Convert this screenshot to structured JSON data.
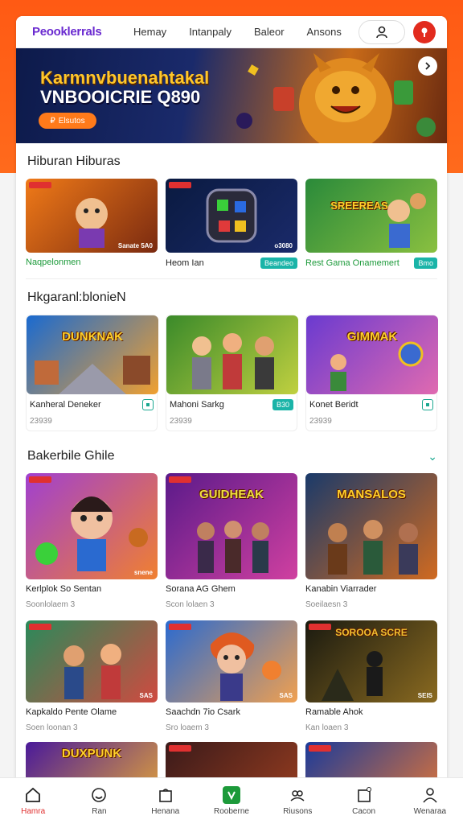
{
  "header": {
    "logo": "Peooklerrals",
    "nav": [
      "Hemay",
      "Intanpaly",
      "Baleor",
      "Ansons"
    ]
  },
  "banner": {
    "title": "Karmnvbuenahtakal",
    "subtitle": "VNBOOICRIE Q890",
    "cta": "Elsutos"
  },
  "sections": [
    {
      "title": "Hiburan Hiburas",
      "cards": [
        {
          "name": "Naqpelonmen",
          "badge": "",
          "thumb_label": "",
          "corner": "Sanate 5A0",
          "colors": [
            "#f07a18",
            "#7a2a10"
          ]
        },
        {
          "name": "Heom Ian",
          "badge": "Beandeo",
          "thumb_label": "",
          "corner": "o3080",
          "colors": [
            "#0a1a40",
            "#1a2a6a"
          ]
        },
        {
          "name": "Rest Gama Onamemert",
          "badge": "Bmo",
          "thumb_label": "SREEREAS",
          "corner": "",
          "colors": [
            "#2a8a3a",
            "#8ac040"
          ]
        }
      ]
    },
    {
      "title": "Hkgaranl:blonieN",
      "cards": [
        {
          "name": "Kanheral Deneker",
          "sub": "23939",
          "badge": "",
          "thumb_label": "DUNKNAK",
          "corner": "",
          "colors": [
            "#1a6ad0",
            "#f0a030"
          ]
        },
        {
          "name": "Mahoni Sarkg",
          "sub": "23939",
          "badge": "B30",
          "thumb_label": "",
          "corner": "",
          "colors": [
            "#3a8a2a",
            "#c0d040"
          ]
        },
        {
          "name": "Konet Beridt",
          "sub": "23939",
          "badge": "",
          "thumb_label": "GIMMAK",
          "corner": "",
          "colors": [
            "#6a3ad0",
            "#e06ab0"
          ]
        }
      ]
    },
    {
      "title": "Bakerbile Ghile",
      "cards": [
        {
          "name": "Kerlplok So Sentan",
          "sub": "Soonlolaem 3",
          "thumb_label": "",
          "corner": "snene",
          "colors": [
            "#a040d0",
            "#f08030"
          ]
        },
        {
          "name": "Sorana AG Ghem",
          "sub": "Scon lolaen 3",
          "thumb_label": "GUIDHEAK",
          "corner": "",
          "colors": [
            "#5a1a8a",
            "#d040a0"
          ]
        },
        {
          "name": "Kanabin Viarrader",
          "sub": "Soeilaesn 3",
          "thumb_label": "MANSALOS",
          "corner": "",
          "colors": [
            "#1a3a6a",
            "#d06a20"
          ]
        }
      ]
    },
    {
      "title": "",
      "cards": [
        {
          "name": "Kapkaldo Pente Olame",
          "sub": "Soen loonan 3",
          "thumb_label": "",
          "corner": "SAS",
          "colors": [
            "#2a8a5a",
            "#d04a40"
          ]
        },
        {
          "name": "Saachdn 7io Csark",
          "sub": "Sro loaem 3",
          "thumb_label": "",
          "corner": "SAS",
          "colors": [
            "#2a6ad0",
            "#f0a050"
          ]
        },
        {
          "name": "Ramable Ahok",
          "sub": "Kan loaen 3",
          "thumb_label": "SOROOA SCRE",
          "corner": "SEIS",
          "colors": [
            "#1a1a10",
            "#8a6a20"
          ]
        }
      ]
    },
    {
      "title": "",
      "cards": [
        {
          "name": "",
          "thumb_label": "DUXPUNK",
          "colors": [
            "#4a1a9a",
            "#f0b030"
          ]
        },
        {
          "name": "",
          "thumb_label": "",
          "colors": [
            "#3a1a1a",
            "#a04020"
          ]
        },
        {
          "name": "",
          "thumb_label": "",
          "colors": [
            "#1a3a9a",
            "#f07a30"
          ]
        }
      ]
    }
  ],
  "bottom_nav": [
    {
      "label": "Hamra",
      "icon": "home-icon",
      "active": true
    },
    {
      "label": "Ran",
      "icon": "smiley-icon",
      "active": false
    },
    {
      "label": "Henana",
      "icon": "bag-icon",
      "active": false
    },
    {
      "label": "Rooberne",
      "icon": "plus-icon",
      "active": false
    },
    {
      "label": "Riusons",
      "icon": "group-icon",
      "active": false
    },
    {
      "label": "Cacon",
      "icon": "box-icon",
      "active": false
    },
    {
      "label": "Wenaraa",
      "icon": "user-icon",
      "active": false
    }
  ]
}
